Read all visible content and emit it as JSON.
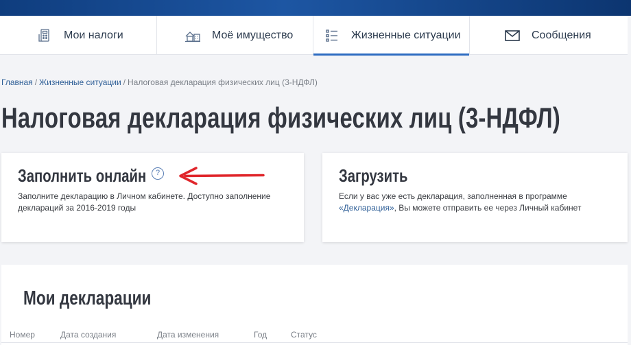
{
  "nav": {
    "items": [
      {
        "label": "Мои налоги",
        "icon": "tax-calculator-icon"
      },
      {
        "label": "Моё имущество",
        "icon": "property-icon"
      },
      {
        "label": "Жизненные ситуации",
        "icon": "list-icon",
        "active": true
      },
      {
        "label": "Сообщения",
        "icon": "envelope-icon"
      }
    ]
  },
  "breadcrumb": {
    "items": [
      "Главная",
      "Жизненные ситуации"
    ],
    "current": "Налоговая декларация физических лиц (3-НДФЛ)",
    "separator": "/"
  },
  "page_title": "Налоговая декларация физических лиц (3-НДФЛ)",
  "cards": {
    "fill_online": {
      "title": "Заполнить онлайн",
      "help_icon": "question-icon",
      "help_symbol": "?",
      "description": "Заполните декларацию в Личном кабинете. Доступно заполнение деклараций за 2016-2019 годы"
    },
    "upload": {
      "title": "Загрузить",
      "description_before": "Если у вас уже есть декларация, заполненная в программе ",
      "link": "«Декларация»",
      "description_after": ", Вы можете отправить ее через Личный кабинет"
    }
  },
  "declarations": {
    "title": "Мои декларации",
    "columns": [
      "Номер",
      "Дата создания",
      "Дата изменения",
      "Год",
      "Статус"
    ]
  },
  "colors": {
    "header_band": "#1d56a3",
    "active_tab_underline": "#2c6bc1",
    "link": "#2f5f97",
    "annotation_arrow": "#e0262b"
  }
}
